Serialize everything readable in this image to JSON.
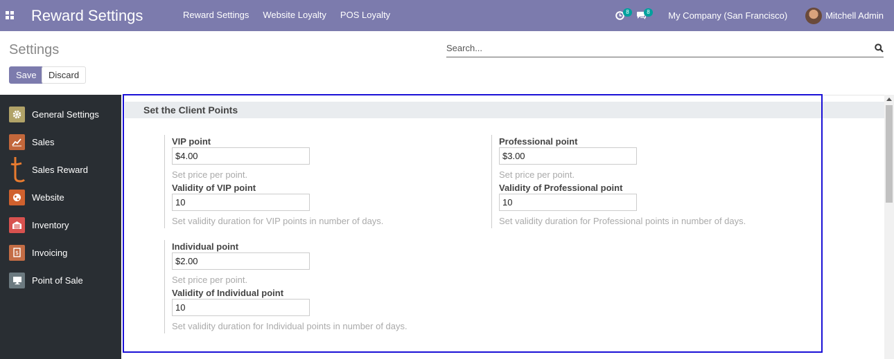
{
  "navbar": {
    "title": "Reward Settings",
    "menu": [
      "Reward Settings",
      "Website Loyalty",
      "POS Loyalty"
    ],
    "activity_count": "8",
    "message_count": "8",
    "company": "My Company (San Francisco)",
    "user": "Mitchell Admin"
  },
  "control_panel": {
    "title": "Settings",
    "search_placeholder": "Search...",
    "save_label": "Save",
    "discard_label": "Discard"
  },
  "sidebar": {
    "items": [
      {
        "label": "General Settings",
        "icon": "gear-icon",
        "color": "#b1a368"
      },
      {
        "label": "Sales",
        "icon": "chart-icon",
        "color": "#c2673b"
      },
      {
        "label": "Sales Reward",
        "icon": "reward-icon",
        "color": "#e87b2f"
      },
      {
        "label": "Website",
        "icon": "globe-icon",
        "color": "#d0612e"
      },
      {
        "label": "Inventory",
        "icon": "warehouse-icon",
        "color": "#d8524f"
      },
      {
        "label": "Invoicing",
        "icon": "invoice-icon",
        "color": "#c46d45"
      },
      {
        "label": "Point of Sale",
        "icon": "monitor-icon",
        "color": "#6c7a80"
      }
    ]
  },
  "section": {
    "title": "Set the Client Points"
  },
  "settings": {
    "vip": {
      "point_label": "VIP point",
      "point_value": "$4.00",
      "point_help": "Set price per point.",
      "validity_label": "Validity of VIP point",
      "validity_value": "10",
      "validity_help": "Set validity duration for VIP points in number of days."
    },
    "professional": {
      "point_label": "Professional point",
      "point_value": "$3.00",
      "point_help": "Set price per point.",
      "validity_label": "Validity of Professional point",
      "validity_value": "10",
      "validity_help": "Set validity duration for Professional points in number of days."
    },
    "individual": {
      "point_label": "Individual point",
      "point_value": "$2.00",
      "point_help": "Set price per point.",
      "validity_label": "Validity of Individual point",
      "validity_value": "10",
      "validity_help": "Set validity duration for Individual points in number of days."
    }
  },
  "colors": {
    "navbar": "#7c7bad",
    "sidebar": "#292e33",
    "highlight": "#1a10d6"
  }
}
